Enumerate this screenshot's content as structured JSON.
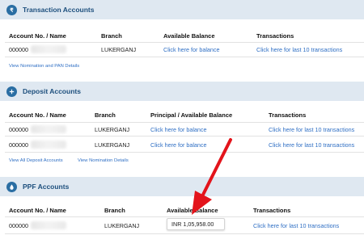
{
  "transaction": {
    "title": "Transaction Accounts",
    "col_account": "Account No. / Name",
    "col_branch": "Branch",
    "col_balance": "Available Balance",
    "col_transactions": "Transactions",
    "row": {
      "account": "000000",
      "branch": "LUKERGANJ",
      "balance": "Click here for balance",
      "transactions": "Click here for last 10 transactions"
    },
    "footer_link": "View Nomination and PAN Details"
  },
  "deposit": {
    "title": "Deposit Accounts",
    "col_account": "Account No. / Name",
    "col_branch": "Branch",
    "col_balance": "Principal / Available Balance",
    "col_transactions": "Transactions",
    "rows": [
      {
        "account": "000000",
        "branch": "LUKERGANJ",
        "balance": "Click here for balance",
        "transactions": "Click here for last 10 transactions"
      },
      {
        "account": "000000",
        "branch": "LUKERGANJ",
        "balance": "Click here for balance",
        "transactions": "Click here for last 10 transactions"
      }
    ],
    "footer_link_all": "View All Deposit Accounts",
    "footer_link_nomination": "View Nomination Details"
  },
  "ppf": {
    "title": "PPF Accounts",
    "col_account": "Account No. / Name",
    "col_branch": "Branch",
    "col_balance": "Available Balance",
    "col_transactions": "Transactions",
    "row": {
      "account": "000000",
      "branch": "LUKERGANJ",
      "balance": "INR 1,05,958.00",
      "transactions": "Click here for last 10 transactions"
    }
  },
  "colors": {
    "header_bg": "#dfe8f1",
    "title": "#1d4f7d",
    "link": "#2f6fc4",
    "arrow": "#e3141b"
  },
  "icons": {
    "transaction": "rupee-coin-icon",
    "deposit": "plus-coin-icon",
    "ppf": "drop-icon"
  }
}
